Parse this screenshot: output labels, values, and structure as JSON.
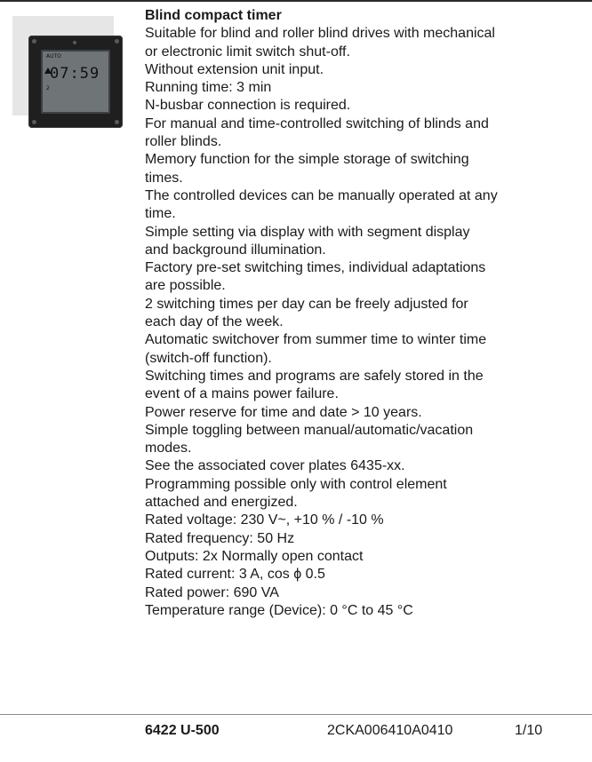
{
  "product": {
    "title": "Blind compact timer",
    "description_lines": [
      "Suitable for blind and roller blind drives with mechanical",
      "or electronic limit switch shut-off.",
      "Without extension unit input.",
      "Running time: 3 min",
      "N-busbar connection is required.",
      "For manual and time-controlled switching of blinds and",
      "roller blinds.",
      "Memory function for the simple storage of switching",
      "times.",
      "The controlled devices can be manually operated at any",
      "time.",
      "Simple setting via display with with segment display",
      "and background illumination.",
      "Factory pre-set switching times, individual adaptations",
      "are possible.",
      "2 switching times per day can be freely adjusted for",
      "each day of the week.",
      "Automatic switchover from summer time to winter time",
      "(switch-off function).",
      "Switching times and programs are safely stored in the",
      "event of a mains power failure.",
      "Power reserve for time and date > 10 years.",
      "Simple toggling between manual/automatic/vacation",
      "modes.",
      "See the associated cover plates 6435-xx.",
      "Programming possible only with control element",
      "attached and energized.",
      "Rated voltage: 230 V~, +10 % / -10 %",
      "Rated frequency: 50 Hz",
      "Outputs: 2x Normally open contact",
      "Rated current: 3 A, cos ϕ 0.5",
      "Rated power: 690 VA",
      "Temperature range (Device): 0 °C to 45 °C"
    ]
  },
  "device_display": {
    "mode": "AUTO",
    "time": "07:59",
    "day": "2"
  },
  "footer": {
    "product_code": "6422 U-500",
    "order_number": "2CKA006410A0410",
    "pack_quantity": "1/10"
  }
}
